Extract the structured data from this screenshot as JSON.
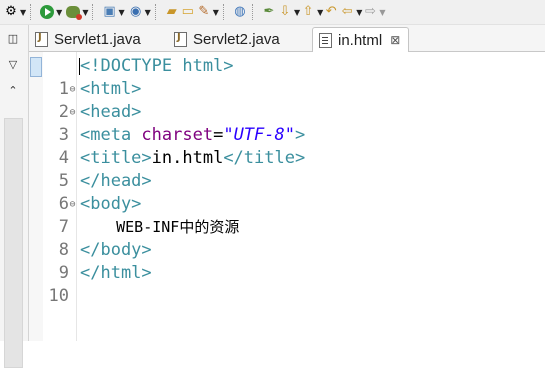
{
  "tabs": [
    {
      "label": "Servlet1.java",
      "icon": "java-file-icon"
    },
    {
      "label": "Servlet2.java",
      "icon": "java-file-icon"
    },
    {
      "label": "in.html",
      "icon": "html-file-icon",
      "active": true,
      "close": "⊠"
    }
  ],
  "editor": {
    "lines": [
      {
        "num": "1",
        "text": "<!DOCTYPE html>"
      },
      {
        "num": "2",
        "fold": "⊖",
        "text": "<html>"
      },
      {
        "num": "3",
        "fold": "⊖",
        "text": "<head>"
      },
      {
        "num": "4",
        "text": "<meta charset=\"UTF-8\">"
      },
      {
        "num": "5",
        "text": "<title>in.html</title>"
      },
      {
        "num": "6",
        "text": "</head>"
      },
      {
        "num": "7",
        "fold": "⊖",
        "text": "<body>"
      },
      {
        "num": "8",
        "text": "    WEB-INF中的资源"
      },
      {
        "num": "9",
        "text": "</body>"
      },
      {
        "num": "10",
        "text": "</html>"
      }
    ],
    "tokens": {
      "doctype": "<!DOCTYPE html>",
      "html_open": "<html>",
      "head_open": "<head>",
      "meta_open": "<meta ",
      "meta_attr": "charset",
      "meta_eq": "=",
      "meta_val": "\"UTF-8\"",
      "meta_close": ">",
      "title_open": "<title>",
      "title_text": "in.html",
      "title_close": "</title>",
      "head_close": "</head>",
      "body_open": "<body>",
      "body_text": "    WEB-INF中的资源",
      "body_close": "</body>",
      "html_close": "</html>"
    }
  },
  "colors": {
    "tag": "#3b8f9e",
    "attribute": "#7f007f",
    "string": "#2a00ff",
    "line_number": "#777777"
  }
}
